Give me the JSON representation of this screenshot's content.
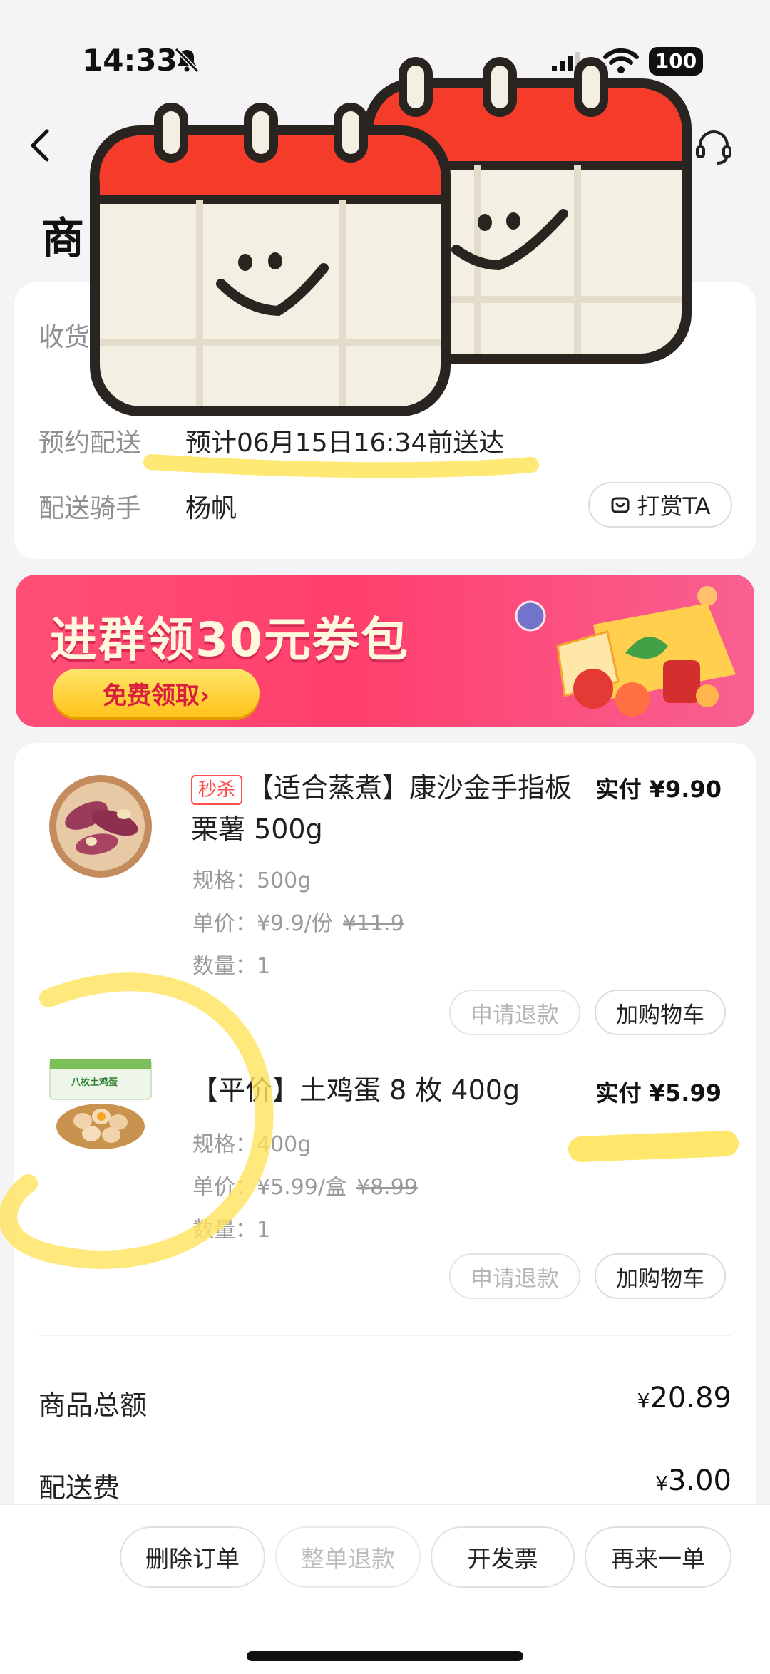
{
  "status_bar": {
    "time": "14:33",
    "battery": "100"
  },
  "header": {
    "title": "商"
  },
  "delivery": {
    "rows": [
      {
        "label": "收货",
        "value": ""
      },
      {
        "label": "预约配送",
        "value": "预计06月15日16:34前送达"
      },
      {
        "label": "配送骑手",
        "value": "杨帆"
      }
    ],
    "tip_button": "打赏TA"
  },
  "banner": {
    "title": "进群领30元券包",
    "button": "免费领取›"
  },
  "items": [
    {
      "tag": "秒杀",
      "title": "【适合蒸煮】康沙金手指板栗薯 500g",
      "paid": "实付 ¥9.90",
      "spec": "规格：500g",
      "unit_price": "单价：¥9.9/份",
      "original_price": "¥11.9",
      "qty": "数量：1",
      "refund": "申请退款",
      "cart": "加购物车"
    },
    {
      "tag": "",
      "title": "【平价】土鸡蛋 8 枚 400g",
      "paid": "实付 ¥5.99",
      "spec": "规格：400g",
      "unit_price": "单价：¥5.99/盒",
      "original_price": "¥8.99",
      "qty": "数量：1",
      "refund": "申请退款",
      "cart": "加购物车",
      "package_label": "八枚土鸡蛋"
    }
  ],
  "summary": [
    {
      "label": "商品总额",
      "currency": "¥",
      "amount": "20.89"
    },
    {
      "label": "配送费",
      "currency": "¥",
      "amount": "3.00"
    }
  ],
  "bottom_bar": {
    "delete": "删除订单",
    "refund_all": "整单退款",
    "invoice": "开发票",
    "reorder": "再来一单"
  },
  "colors": {
    "accent": "#ff4d4f",
    "banner": "#ff4f76",
    "highlight": "#ffe45c",
    "calendar_red": "#f53b2a"
  }
}
